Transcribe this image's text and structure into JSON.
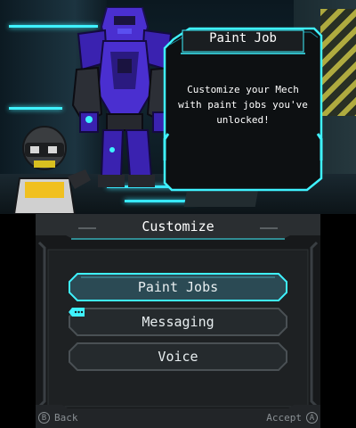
{
  "top_screen": {
    "dialog": {
      "title": "Paint Job",
      "message": "Customize your Mech with paint jobs you've unlocked!"
    }
  },
  "bottom_screen": {
    "title": "Customize",
    "menu": [
      {
        "label": "Paint Jobs",
        "selected": true
      },
      {
        "label": "Messaging",
        "selected": false
      },
      {
        "label": "Voice",
        "selected": false
      }
    ],
    "footer": {
      "back_key": "B",
      "back_label": "Back",
      "accept_key": "A",
      "accept_label": "Accept"
    }
  },
  "colors": {
    "accent_cyan": "#3ff2ff",
    "mech_purple": "#4a2fd0",
    "panel_dark": "#17191b"
  }
}
